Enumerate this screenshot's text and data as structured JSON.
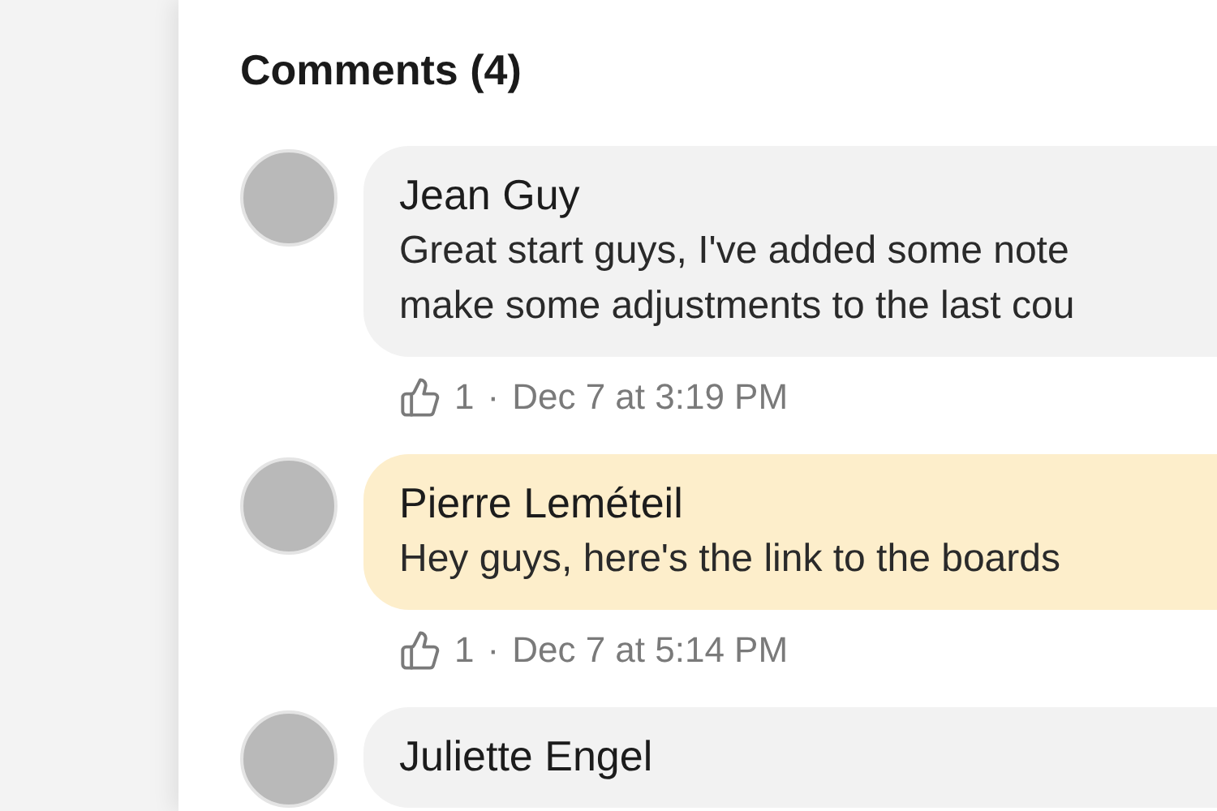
{
  "title": "Comments (4)",
  "comments": [
    {
      "author": "Jean Guy",
      "lines": [
        "Great start guys, I've added some note",
        "make some adjustments to the last cou"
      ],
      "likes": "1",
      "separator": "·",
      "time": "Dec 7 at 3:19 PM",
      "highlighted": false
    },
    {
      "author": "Pierre Leméteil",
      "lines": [
        "Hey guys, here's the link to the boards"
      ],
      "likes": "1",
      "separator": "·",
      "time": "Dec 7 at 5:14 PM",
      "highlighted": true
    },
    {
      "author": "Juliette Engel",
      "highlighted": false
    }
  ]
}
